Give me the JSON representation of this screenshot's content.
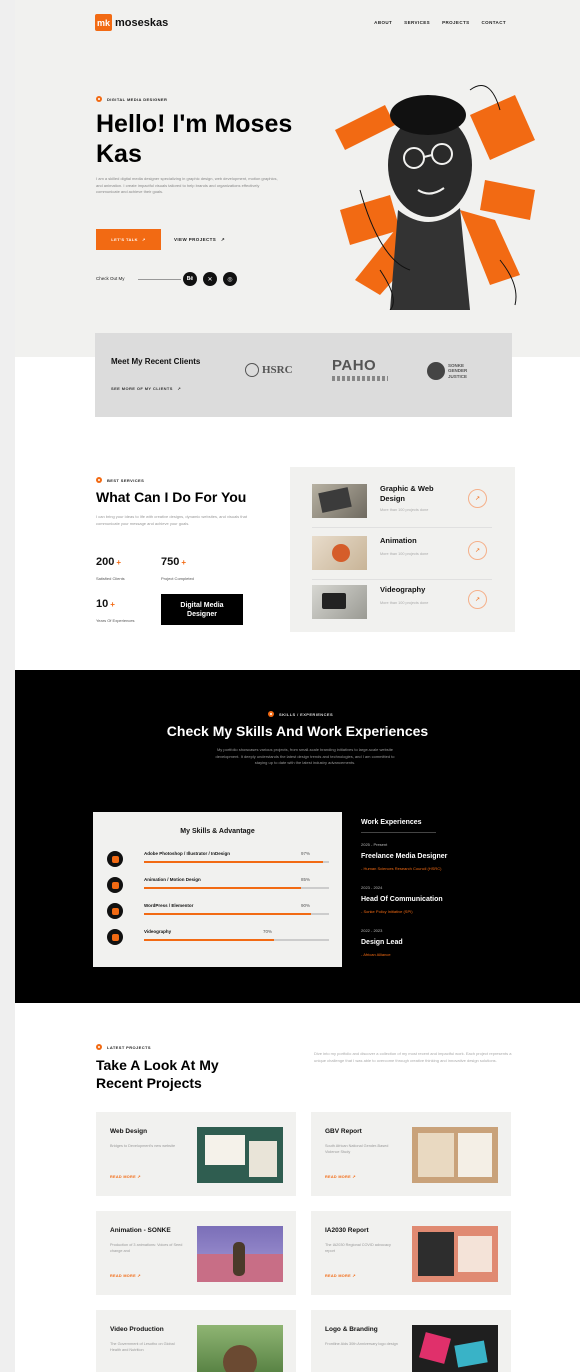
{
  "brand": {
    "mark": "mk",
    "name": "moseskas",
    "accent": "#f26a13"
  },
  "nav": [
    "ABOUT",
    "SERVICES",
    "PROJECTS",
    "CONTACT"
  ],
  "hero": {
    "eyebrow": "DIGITAL MEDIA DESIGNER",
    "title": "Hello! I'm Moses Kas",
    "desc": "I am a skilled digital media designer specializing in graphic design, web development, motion graphics, and animation. I create impactful visuals tailored to help brands and organizations effectively communicate and achieve their goals.",
    "cta": "LET'S TALK",
    "secondary": "VIEW PROJECTS",
    "social_label": "Check Out My",
    "social_icons": [
      "behance-icon",
      "x-icon",
      "instagram-icon"
    ]
  },
  "clients": {
    "title": "Meet My Recent Clients",
    "link": "SEE MORE OF MY CLIENTS",
    "logos": [
      "HSRC",
      "PAHO",
      "SONKE GENDER JUSTICE"
    ]
  },
  "services": {
    "eyebrow": "BEST SERVICES",
    "title": "What Can I Do For You",
    "desc": "I can bring your ideas to life with creative designs, dynamic websites, and visuals that communicate your message and achieve your goals.",
    "stats": [
      {
        "num": "200",
        "label": "Satisfied Clients"
      },
      {
        "num": "750",
        "label": "Project Completed"
      },
      {
        "num": "10",
        "label": "Years Of Experiences"
      }
    ],
    "badge": "Digital Media Designer",
    "items": [
      {
        "name": "Graphic & Web Design",
        "sub": "More than 100 projects done"
      },
      {
        "name": "Animation",
        "sub": "More than 100 projects done"
      },
      {
        "name": "Videography",
        "sub": "More than 100 projects done"
      }
    ]
  },
  "skills": {
    "eyebrow": "SKILLS / EXPERIENCES",
    "title": "Check My Skills And Work Experiences",
    "desc": "My portfolio showcases various projects, from small-scale branding initiatives to large-scale website development. It deeply understands the latest design trends and technologies, and I am committed to staying up to date with the latest industry advancements.",
    "card_title": "My Skills & Advantage",
    "items": [
      {
        "name": "Adobe Photoshop / Illustrator / InDesign",
        "pct": "97%",
        "value": 0.97
      },
      {
        "name": "Animation / Motion Design",
        "pct": "85%",
        "value": 0.85
      },
      {
        "name": "WordPress / Elementor",
        "pct": "90%",
        "value": 0.9
      },
      {
        "name": "Videography",
        "pct": "70%",
        "value": 0.7
      }
    ],
    "work_title": "Work Experiences",
    "work": [
      {
        "date": "2025 - Present",
        "role": "Freelance Media Designer",
        "org": "- Human Sciences Research Council (HSRC)"
      },
      {
        "date": "2023 - 2024",
        "role": "Head Of Communication",
        "org": "- Sonke Policy Initiative (SPI)"
      },
      {
        "date": "2022 - 2023",
        "role": "Design Lead",
        "org": "- African Alliance"
      }
    ]
  },
  "projects": {
    "eyebrow": "LATEST PROJECTS",
    "title": "Take A Look At My Recent Projects",
    "desc": "Dive into my portfolio and discover a collection of my most recent and impactful work. Each project represents a unique challenge that I was able to overcome through creative thinking and innovative design solutions.",
    "read_more": "READ MORE",
    "items": [
      {
        "title": "Web Design",
        "sub": "Bridges to Development's new website"
      },
      {
        "title": "GBV Report",
        "sub": "South African National Gender-Based Violence Study"
      },
      {
        "title": "Animation - SONKE",
        "sub": "Production of 3 animations: Voices of Seed change and"
      },
      {
        "title": "IA2030 Report",
        "sub": "The IA2030 Regional COVID advocacy report"
      },
      {
        "title": "Video Production",
        "sub": "The Government of Lesotho on Global Health and Nutrition"
      },
      {
        "title": "Logo & Branding",
        "sub": "Frontline Aids 30th Anniversary logo design"
      }
    ]
  }
}
